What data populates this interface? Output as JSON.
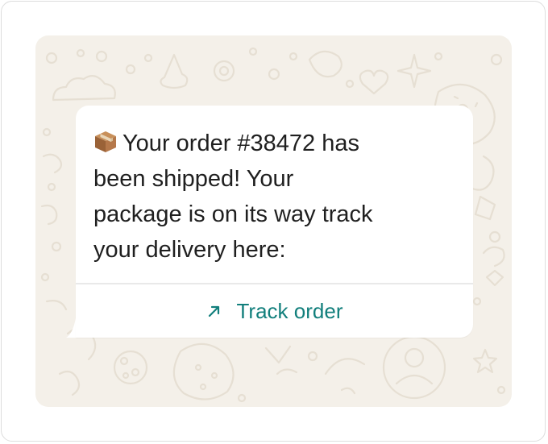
{
  "message": {
    "icon": "package-icon",
    "text": "Your order #38472 has\nbeen shipped! Your\npackage is on its way track\nyour delivery here:"
  },
  "action": {
    "icon": "arrow-up-right-icon",
    "label": "Track order"
  },
  "colors": {
    "chat_background": "#f4f0e9",
    "bubble_background": "#ffffff",
    "link_color": "#127f7c",
    "text_color": "#1f1f1f"
  }
}
